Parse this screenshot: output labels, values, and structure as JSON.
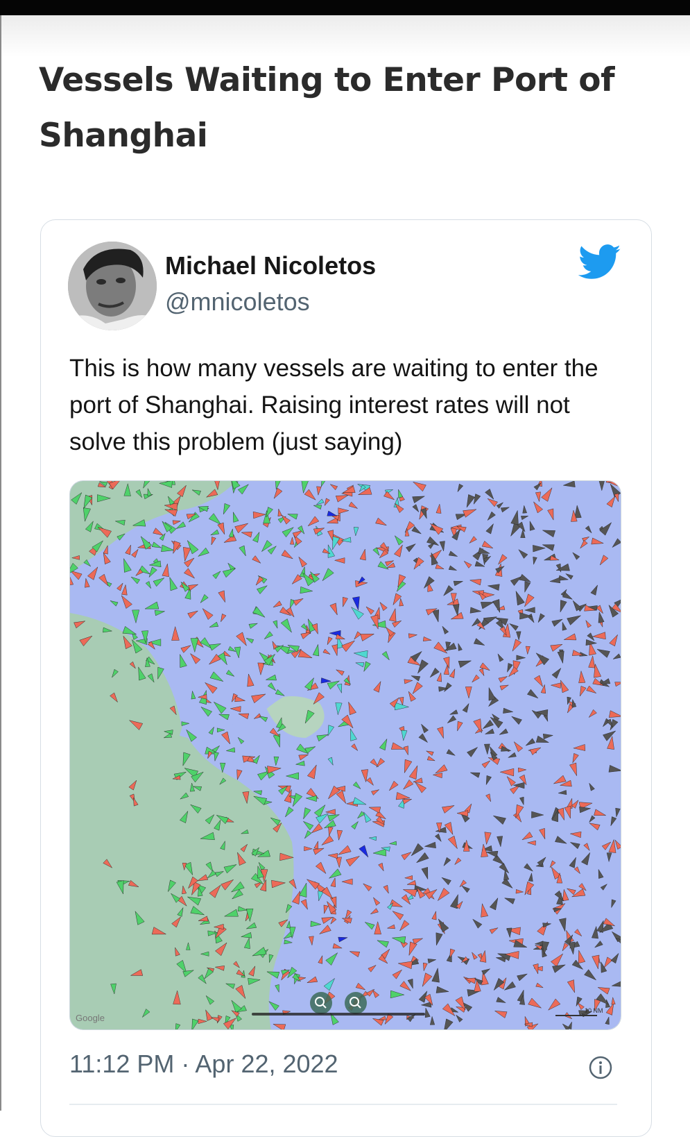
{
  "article": {
    "title": "Vessels Waiting to Enter Port of Shanghai"
  },
  "tweet": {
    "author_name": "Michael Nicoletos",
    "author_handle": "@mnicoletos",
    "text": "This is how many vessels are waiting to enter the port of Shanghai. Raising interest rates will not solve this problem (just saying)",
    "timestamp": "11:12 PM · Apr 22, 2022",
    "icons": {
      "platform": "twitter-bird-icon",
      "info": "info-icon",
      "zoom_in": "zoom-in-icon",
      "zoom_out": "zoom-out-icon"
    },
    "media": {
      "map_attribution": "Google",
      "scale_label": "10 NM"
    }
  },
  "colors": {
    "brand_twitter": "#1d9bf0",
    "sea": "#a9b9f2",
    "land": "#a8ccb4",
    "vessel_red": "#ec6a58",
    "vessel_green": "#4fd16a",
    "vessel_cyan": "#4fd8d0",
    "vessel_dark": "#555555",
    "vessel_blue": "#1a2ae0"
  }
}
